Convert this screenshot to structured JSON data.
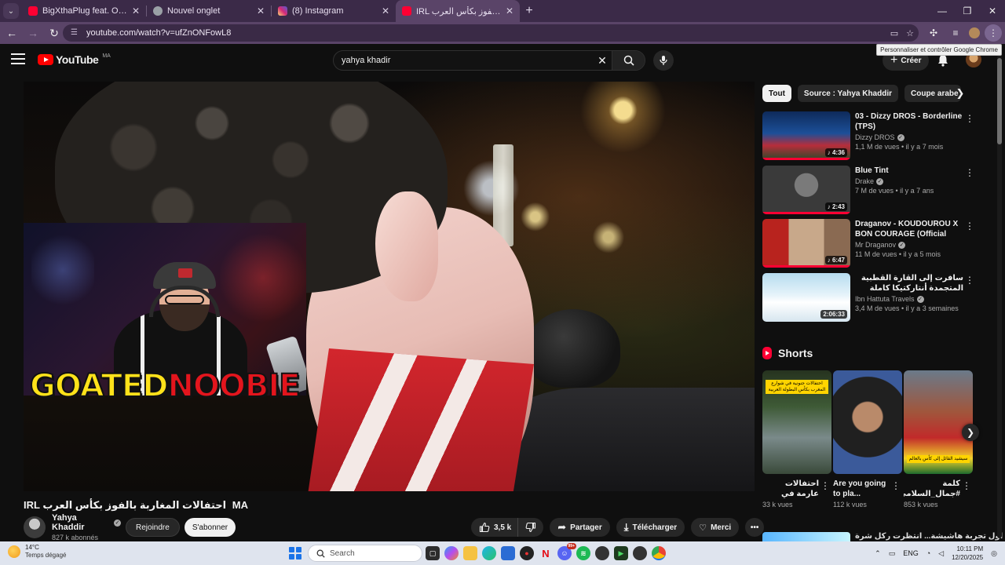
{
  "browser": {
    "tabs": [
      {
        "title": "BigXthaPlug feat. Offset - Clim",
        "favicon_color": "#ff0033",
        "active": false
      },
      {
        "title": "Nouvel onglet",
        "favicon_color": "#9aa0a6",
        "active": false
      },
      {
        "title": "(8) Instagram",
        "favicon_color": "#d6249f",
        "active": false
      },
      {
        "title": "IRL احتفالات المغاربة بالفوز بكأس العرب",
        "favicon_color": "#ff0033",
        "active": true
      }
    ],
    "url": "youtube.com/watch?v=ufZnONFowL8",
    "tooltip": "Personnaliser et contrôler Google Chrome"
  },
  "header": {
    "logo_text": "YouTube",
    "country_code": "MA",
    "search_value": "yahya khadir",
    "create_label": "Créer"
  },
  "video": {
    "overlay_brand_part1": "GOATED",
    "overlay_brand_part2": "NOOBIE",
    "title_badge": "MA",
    "title": "IRL احتفالات المغاربة بالفوز بكأس العرب",
    "channel_name": "Yahya Khaddir",
    "subscribers": "827 k abonnés",
    "join_label": "Rejoindre",
    "subscribe_label": "S'abonner",
    "likes": "3,5 k",
    "share_label": "Partager",
    "download_label": "Télécharger",
    "thanks_label": "Merci"
  },
  "sidebar": {
    "chips": [
      "Tout",
      "Source : Yahya Khaddir",
      "Coupe arabe de"
    ],
    "recommendations": [
      {
        "title": "03 - Dizzy DROS - Borderline (TPS)",
        "channel": "Dizzy DROS",
        "meta": "1,1 M de vues • il y a 7 mois",
        "duration": "4:36"
      },
      {
        "title": "Blue Tint",
        "channel": "Drake",
        "meta": "7 M de vues • il y a 7 ans",
        "duration": "2:43"
      },
      {
        "title": "Draganov - KOUDOUROU X BON COURAGE (Official Music Video)",
        "channel": "Mr Draganov",
        "meta": "11 M de vues • il y a 5 mois",
        "duration": "6:47"
      },
      {
        "title": "سافرت إلى القارة القطبية المتجمدة أنتاركتيكا كاملة وتكاليف التجربة AQ",
        "channel": "Ibn Hattuta Travels",
        "meta": "3,4 M de vues • il y a 3 semaines",
        "duration": "2:06:33"
      }
    ],
    "shorts_title": "Shorts",
    "shorts": [
      {
        "title": "احتفالات عارمة في شوارع ...",
        "views": "33 k vues",
        "caption": "احتفالات جنونية في شوارع المغرب بكأس البطولة العربية"
      },
      {
        "title": "Are you going to pla...",
        "views": "112 k vues",
        "caption": ""
      },
      {
        "title": "كلمة #جمال_السلامي...",
        "views": "853 k vues",
        "caption": "سيشيد القائل إلى كأس بالعالم"
      }
    ],
    "peek_title": "أول تجربة هاشيشة... انتظرت ركل شرة"
  },
  "taskbar": {
    "temperature": "14°C",
    "condition": "Temps dégagé",
    "search_placeholder": "Search",
    "language": "ENG",
    "time": "10:11 PM",
    "date": "12/20/2025",
    "badge_count": "99+"
  },
  "colors": {
    "yt_red": "#ff0000",
    "progress_red": "#ff0033",
    "tab_bg": "#3b2a48",
    "toolbar_bg": "#5a4468"
  }
}
